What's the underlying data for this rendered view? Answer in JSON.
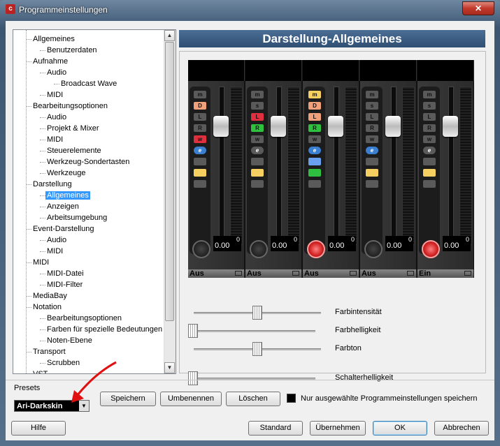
{
  "window": {
    "title": "Programmeinstellungen",
    "close_label": "✕"
  },
  "tree": [
    {
      "label": "Allgemeines",
      "level": 0
    },
    {
      "label": "Benutzerdaten",
      "level": 1
    },
    {
      "label": "Aufnahme",
      "level": 0
    },
    {
      "label": "Audio",
      "level": 1
    },
    {
      "label": "Broadcast Wave",
      "level": 2
    },
    {
      "label": "MIDI",
      "level": 1
    },
    {
      "label": "Bearbeitungsoptionen",
      "level": 0
    },
    {
      "label": "Audio",
      "level": 1
    },
    {
      "label": "Projekt & Mixer",
      "level": 1
    },
    {
      "label": "MIDI",
      "level": 1
    },
    {
      "label": "Steuerelemente",
      "level": 1
    },
    {
      "label": "Werkzeug-Sondertasten",
      "level": 1
    },
    {
      "label": "Werkzeuge",
      "level": 1
    },
    {
      "label": "Darstellung",
      "level": 0
    },
    {
      "label": "Allgemeines",
      "level": 1,
      "selected": true
    },
    {
      "label": "Anzeigen",
      "level": 1
    },
    {
      "label": "Arbeitsumgebung",
      "level": 1
    },
    {
      "label": "Event-Darstellung",
      "level": 0
    },
    {
      "label": "Audio",
      "level": 1
    },
    {
      "label": "MIDI",
      "level": 1
    },
    {
      "label": "MIDI",
      "level": 0
    },
    {
      "label": "MIDI-Datei",
      "level": 1
    },
    {
      "label": "MIDI-Filter",
      "level": 1
    },
    {
      "label": "MediaBay",
      "level": 0
    },
    {
      "label": "Notation",
      "level": 0
    },
    {
      "label": "Bearbeitungsoptionen",
      "level": 1
    },
    {
      "label": "Farben für spezielle Bedeutungen",
      "level": 1
    },
    {
      "label": "Noten-Ebene",
      "level": 1
    },
    {
      "label": "Transport",
      "level": 0
    },
    {
      "label": "Scrubben",
      "level": 1
    },
    {
      "label": "VST",
      "level": 0
    }
  ],
  "panel": {
    "title": "Darstellung-Allgemeines"
  },
  "mixer": {
    "channels": [
      {
        "label": "Aus",
        "value": "0.00",
        "peak": "0",
        "rec_on": false
      },
      {
        "label": "Aus",
        "value": "0.00",
        "peak": "0",
        "rec_on": false
      },
      {
        "label": "Aus",
        "value": "0.00",
        "peak": "0",
        "rec_on": true
      },
      {
        "label": "Aus",
        "value": "0.00",
        "peak": "0",
        "rec_on": false
      },
      {
        "label": "Ein",
        "value": "0.00",
        "peak": "0",
        "rec_on": true
      }
    ],
    "button_letters": {
      "m": "m",
      "s": "s",
      "l": "L",
      "r": "R",
      "w": "w",
      "d": "D",
      "e": "e"
    }
  },
  "sliders": [
    {
      "label": "Farbintensität",
      "position": 0.5
    },
    {
      "label": "Farbhelligkeit",
      "position": 0.0
    },
    {
      "label": "Farbton",
      "position": 0.5
    },
    {
      "label": "Schalterhelligkeit",
      "position": 0.0
    }
  ],
  "presets": {
    "label": "Presets",
    "selected": "Ari-Darkskin",
    "save": "Speichern",
    "rename": "Umbenennen",
    "delete": "Löschen",
    "only_selected_label": "Nur ausgewählte Programmeinstellungen speichern"
  },
  "footer": {
    "help": "Hilfe",
    "standard": "Standard",
    "apply": "Übernehmen",
    "ok": "OK",
    "cancel": "Abbrechen"
  },
  "colors": {
    "selection": "#3399ff",
    "annotation_arrow": "#e01010",
    "record_active": "#d02020"
  }
}
